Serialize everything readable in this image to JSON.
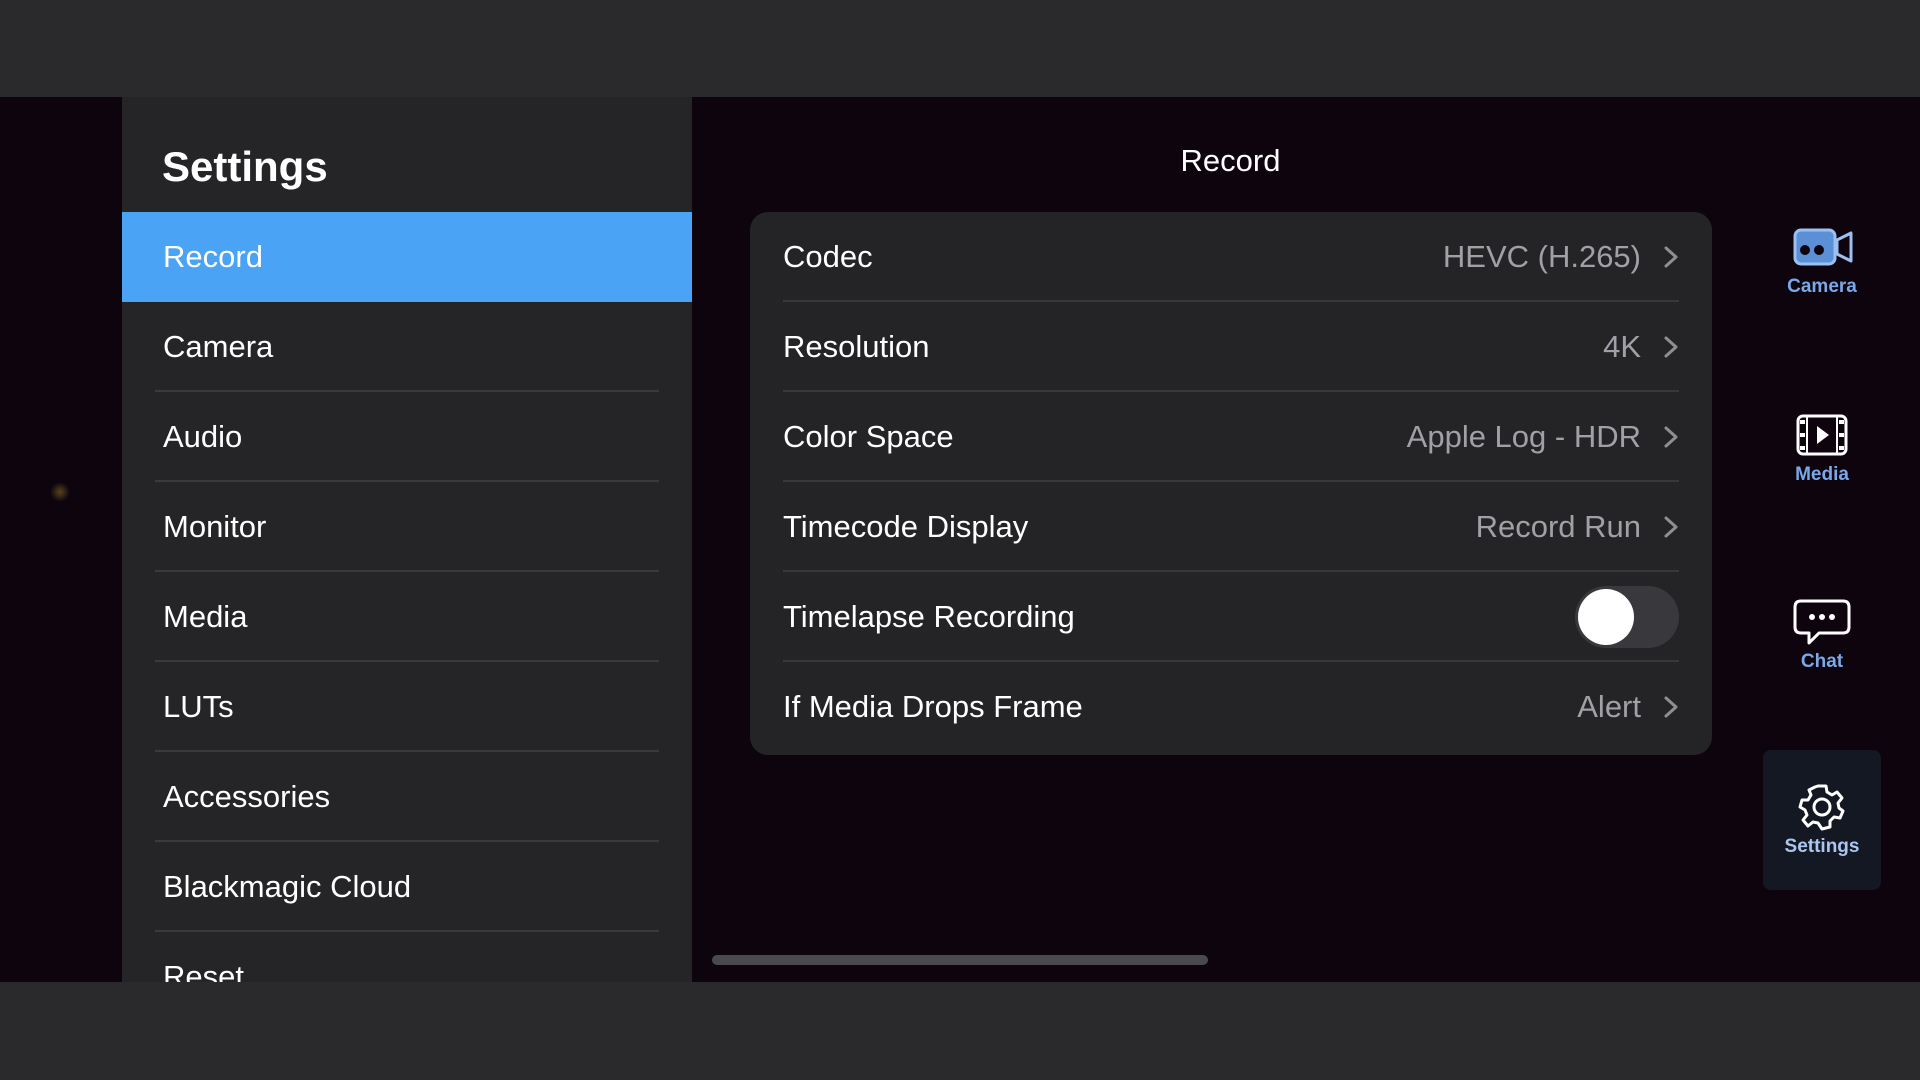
{
  "sidebar": {
    "title": "Settings",
    "items": [
      {
        "label": "Record"
      },
      {
        "label": "Camera"
      },
      {
        "label": "Audio"
      },
      {
        "label": "Monitor"
      },
      {
        "label": "Media"
      },
      {
        "label": "LUTs"
      },
      {
        "label": "Accessories"
      },
      {
        "label": "Blackmagic Cloud"
      },
      {
        "label": "Reset"
      }
    ],
    "active": "Record"
  },
  "main": {
    "title": "Record",
    "rows": [
      {
        "label": "Codec",
        "value": "HEVC (H.265)"
      },
      {
        "label": "Resolution",
        "value": "4K"
      },
      {
        "label": "Color Space",
        "value": "Apple Log - HDR"
      },
      {
        "label": "Timecode Display",
        "value": "Record Run"
      },
      {
        "label": "Timelapse Recording",
        "toggle": false
      },
      {
        "label": "If Media Drops Frame",
        "value": "Alert"
      }
    ]
  },
  "rail": {
    "items": [
      {
        "label": "Camera",
        "icon": "video-camera-icon"
      },
      {
        "label": "Media",
        "icon": "film-play-icon"
      },
      {
        "label": "Chat",
        "icon": "chat-bubble-icon"
      },
      {
        "label": "Settings",
        "icon": "gear-icon"
      }
    ],
    "active": "Settings"
  },
  "colors": {
    "accent": "#4aa3f5",
    "rail_label": "#7aa8e8",
    "background": "#0d040e",
    "panel": "#252528"
  }
}
